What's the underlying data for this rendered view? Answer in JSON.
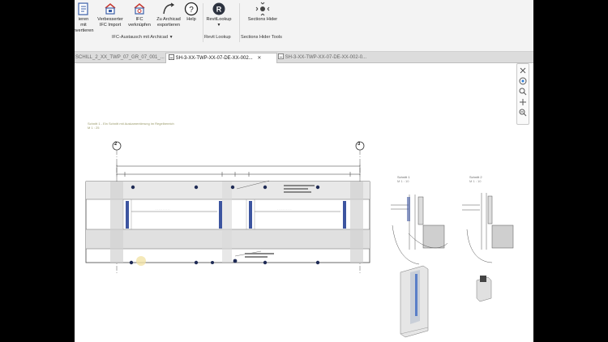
{
  "ribbon": {
    "buttons": [
      {
        "id": "publish",
        "label1": "ieren",
        "label2": "mit",
        "label3": "nvertieren"
      },
      {
        "id": "ifc_import",
        "label1": "Verbesserter",
        "label2": "IFC Import",
        "label3": ""
      },
      {
        "id": "ifc_link",
        "label1": "IFC",
        "label2": "verknüpfen",
        "label3": ""
      },
      {
        "id": "archicad_export",
        "label1": "Zu Archicad",
        "label2": "exportieren",
        "label3": ""
      },
      {
        "id": "help",
        "label1": "Help",
        "label2": "",
        "label3": ""
      },
      {
        "id": "revitlookup",
        "label1": "RevitLookup",
        "label2": "",
        "label3": ""
      },
      {
        "id": "sections_hider",
        "label1": "Sections Hider",
        "label2": "",
        "label3": ""
      }
    ],
    "groups": [
      {
        "id": "ifc",
        "label": "IFC-Austausch mit Archicad"
      },
      {
        "id": "revitlookup",
        "label": "Revit Lookup"
      },
      {
        "id": "sections",
        "label": "Sections Hider Tools"
      }
    ],
    "brand_colors": {
      "ifc_blue": "#3b5fa8",
      "ifc_red": "#c8382f",
      "dark": "#222222"
    }
  },
  "tabs": [
    {
      "label": "SCHILL_2_XX_TWP_07_GR_07_001_...",
      "active": false
    },
    {
      "label": "SH-3-XX-TWP-XX-07-DE-XX-002...",
      "active": true
    },
    {
      "label": "SH-3-XX-TWP-XX-07-DE-XX-002-0...",
      "active": false
    }
  ],
  "drawing": {
    "grid_left": "2",
    "grid_right": "3",
    "title_main": "Schnitt 1 - Ein Schnitt mit Auskamentierung im Regelbereich",
    "title_sub": "M 1 : 25",
    "detail_1": "Schnitt 1",
    "detail_2": "Schnitt 2",
    "detail_scale": "M 1 : 10"
  }
}
